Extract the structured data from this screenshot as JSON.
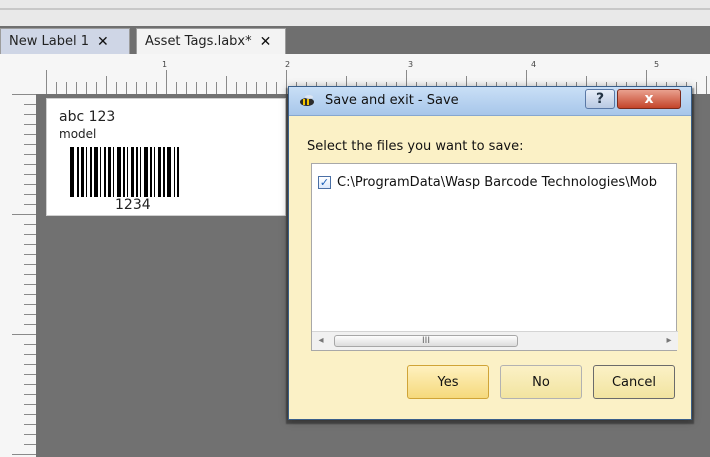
{
  "tabs": [
    {
      "label": "New Label 1",
      "close": "✕"
    },
    {
      "label": "Asset Tags.labx*",
      "close": "✕"
    }
  ],
  "ruler": {
    "numbers": [
      "1",
      "2",
      "3",
      "4",
      "5"
    ]
  },
  "label_preview": {
    "title": "abc 123",
    "subtitle": "model",
    "barcode_text": "1234"
  },
  "dialog": {
    "title": "Save and exit - Save",
    "help": "?",
    "close": "x",
    "prompt": "Select the files you want to save:",
    "files": [
      {
        "path": "C:\\ProgramData\\Wasp Barcode Technologies\\Mob",
        "checked": true
      }
    ],
    "scroll_thumb": "III",
    "buttons": {
      "yes": "Yes",
      "no": "No",
      "cancel": "Cancel"
    }
  },
  "colors": {
    "canvas": "#717171",
    "dialog_bg": "#fbf1c6",
    "titlebar": "#b9d4f1",
    "primary_btn": "#f5d97c"
  },
  "icons": {
    "app": "bee-icon",
    "checkbox": "checkmark-icon",
    "left_arrow": "scroll-left-icon",
    "right_arrow": "scroll-right-icon"
  }
}
